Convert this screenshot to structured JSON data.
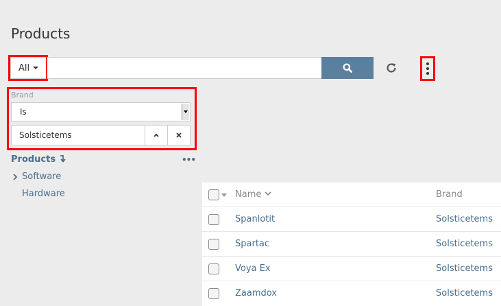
{
  "page": {
    "title": "Products"
  },
  "search": {
    "scope_label": "All",
    "query": "",
    "placeholder": ""
  },
  "filter": {
    "field_label": "Brand",
    "operator": "Is",
    "value": "Solsticetems"
  },
  "tree": {
    "header": "Products",
    "items": [
      {
        "label": "Software",
        "expandable": true
      },
      {
        "label": "Hardware",
        "expandable": false
      }
    ]
  },
  "table": {
    "columns": [
      {
        "label": "Name",
        "sorted": "desc"
      },
      {
        "label": "Brand"
      }
    ],
    "rows": [
      {
        "name": "Spanlotit",
        "brand": "Solsticetems"
      },
      {
        "name": "Spartac",
        "brand": "Solsticetems"
      },
      {
        "name": "Voya Ex",
        "brand": "Solsticetems"
      },
      {
        "name": "Zaamdox",
        "brand": "Solsticetems"
      }
    ]
  },
  "colors": {
    "accent": "#5b7f9e",
    "link": "#4a6f8e",
    "highlight": "#ff0000",
    "background": "#ececec"
  },
  "icons": {
    "search": "search-icon",
    "refresh": "refresh-icon",
    "more": "kebab-icon",
    "chevron_up": "chevron-up-icon",
    "clear": "close-icon",
    "tree_expand": "chevron-right-icon",
    "sort": "sort-down-icon"
  }
}
